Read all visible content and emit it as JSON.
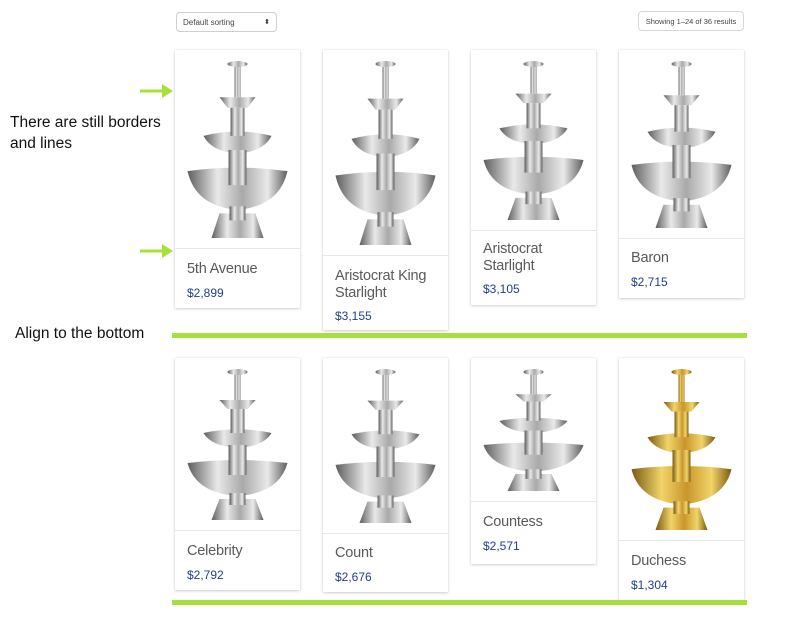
{
  "toolbar": {
    "sort_label": "Default sorting",
    "result_count": "Showing 1–24 of 36 results"
  },
  "products": [
    {
      "name": "5th Avenue",
      "price": "$2,899",
      "finish": "silver"
    },
    {
      "name": "Aristocrat King Starlight",
      "price": "$3,155",
      "finish": "silver"
    },
    {
      "name": "Aristocrat Starlight",
      "price": "$3,105",
      "finish": "silver"
    },
    {
      "name": "Baron",
      "price": "$2,715",
      "finish": "silver"
    },
    {
      "name": "Celebrity",
      "price": "$2,792",
      "finish": "silver"
    },
    {
      "name": "Count",
      "price": "$2,676",
      "finish": "silver"
    },
    {
      "name": "Countess",
      "price": "$2,571",
      "finish": "silver"
    },
    {
      "name": "Duchess",
      "price": "$1,304",
      "finish": "gold"
    }
  ],
  "annotations": {
    "borders_note": "There are still borders and lines",
    "align_note": "Align to the bottom"
  },
  "colors": {
    "price": "#233d8f",
    "annotation_green": "#a7e03a",
    "silver": "#b9b9b9",
    "gold": "#d4a52a"
  }
}
